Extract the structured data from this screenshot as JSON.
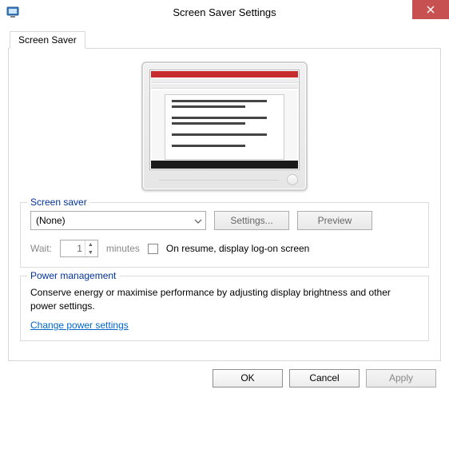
{
  "window": {
    "title": "Screen Saver Settings",
    "close_tooltip": "Close"
  },
  "tab": {
    "label": "Screen Saver"
  },
  "group_screensaver": {
    "legend": "Screen saver",
    "selected": "(None)",
    "settings_btn": "Settings...",
    "preview_btn": "Preview",
    "wait_label": "Wait:",
    "wait_value": "1",
    "minutes_label": "minutes",
    "resume_label": "On resume, display log-on screen"
  },
  "group_power": {
    "legend": "Power management",
    "text": "Conserve energy or maximise performance by adjusting display brightness and other power settings.",
    "link": "Change power settings"
  },
  "footer": {
    "ok": "OK",
    "cancel": "Cancel",
    "apply": "Apply"
  }
}
